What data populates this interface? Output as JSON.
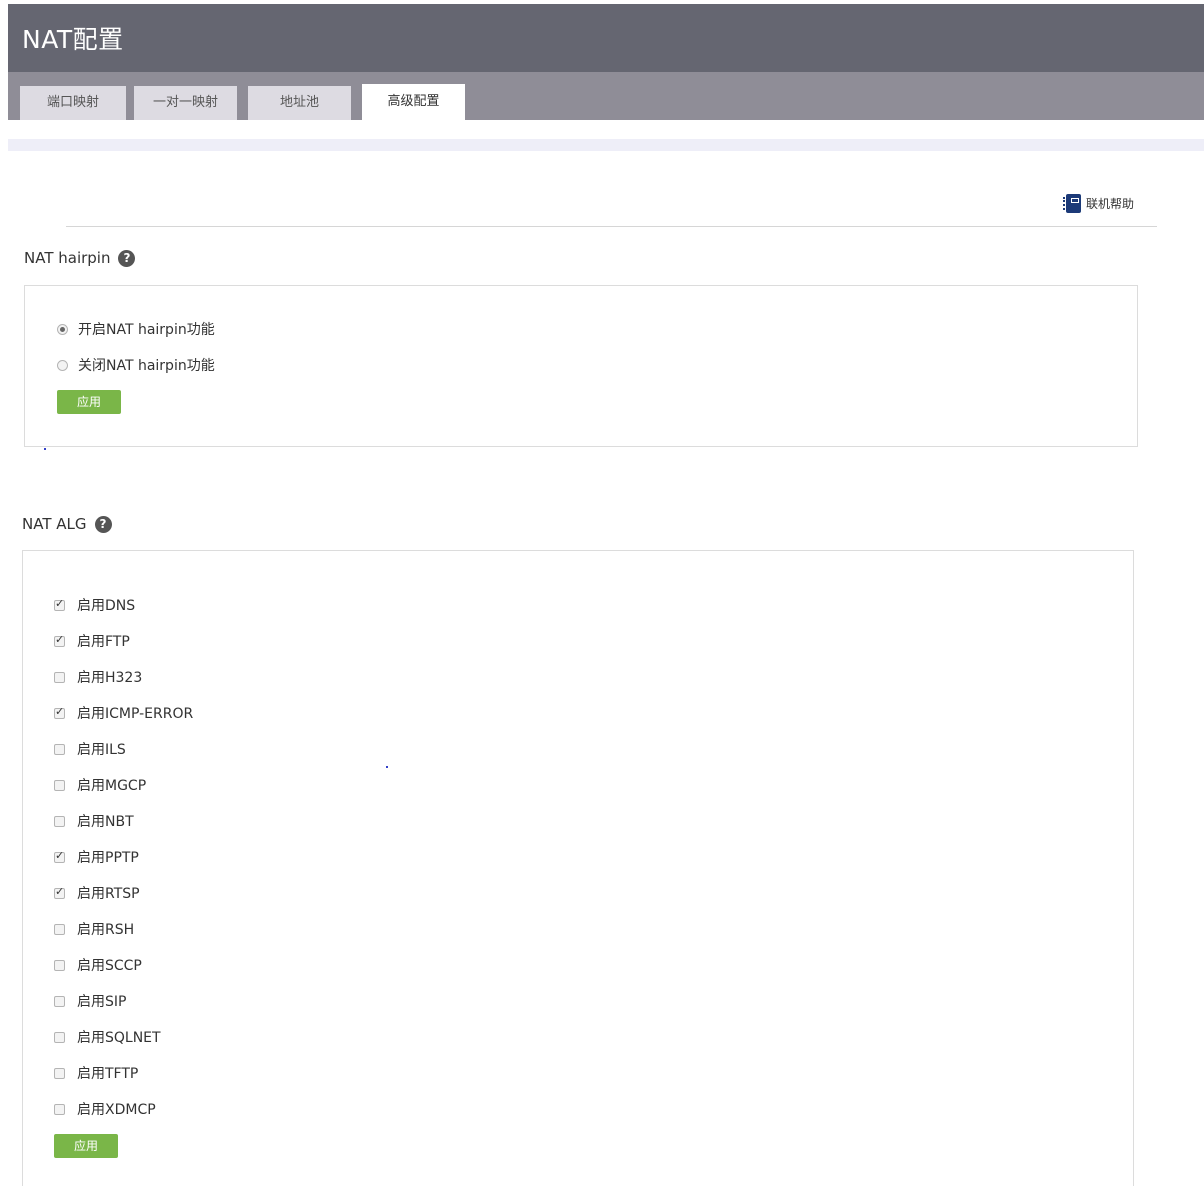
{
  "header": {
    "title": "NAT配置"
  },
  "tabs": [
    {
      "label": "端口映射",
      "active": false
    },
    {
      "label": "一对一映射",
      "active": false
    },
    {
      "label": "地址池",
      "active": false
    },
    {
      "label": "高级配置",
      "active": true
    }
  ],
  "help": {
    "label": "联机帮助",
    "icon": "help-book-icon"
  },
  "hairpin": {
    "title": "NAT hairpin",
    "help_icon": "question-icon",
    "options": [
      {
        "label": "开启NAT hairpin功能",
        "selected": true
      },
      {
        "label": "关闭NAT hairpin功能",
        "selected": false
      }
    ],
    "apply_label": "应用"
  },
  "alg": {
    "title": "NAT ALG",
    "help_icon": "question-icon",
    "items": [
      {
        "label": "启用DNS",
        "checked": true
      },
      {
        "label": "启用FTP",
        "checked": true
      },
      {
        "label": "启用H323",
        "checked": false
      },
      {
        "label": "启用ICMP-ERROR",
        "checked": true
      },
      {
        "label": "启用ILS",
        "checked": false
      },
      {
        "label": "启用MGCP",
        "checked": false
      },
      {
        "label": "启用NBT",
        "checked": false
      },
      {
        "label": "启用PPTP",
        "checked": true
      },
      {
        "label": "启用RTSP",
        "checked": true
      },
      {
        "label": "启用RSH",
        "checked": false
      },
      {
        "label": "启用SCCP",
        "checked": false
      },
      {
        "label": "启用SIP",
        "checked": false
      },
      {
        "label": "启用SQLNET",
        "checked": false
      },
      {
        "label": "启用TFTP",
        "checked": false
      },
      {
        "label": "启用XDMCP",
        "checked": false
      }
    ],
    "apply_label": "应用"
  },
  "colors": {
    "title_bar": "#656671",
    "tab_bar": "#8f8d97",
    "tab_inactive": "#dddbe2",
    "apply_button": "#7ab648"
  }
}
